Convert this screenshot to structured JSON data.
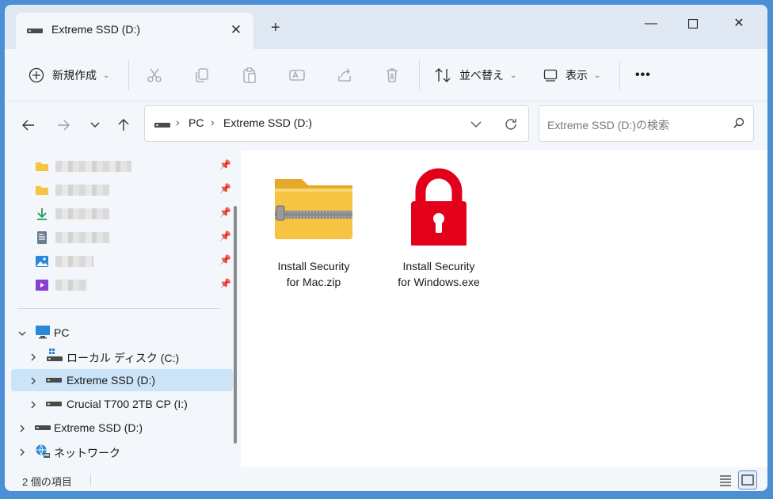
{
  "tab": {
    "title": "Extreme SSD (D:)",
    "close": "✕",
    "new_tab": "+"
  },
  "window_controls": {
    "minimize": "—",
    "maximize": "☐",
    "close": "✕"
  },
  "toolbar": {
    "new_label": "新規作成",
    "sort_label": "並べ替え",
    "view_label": "表示",
    "more_label": "•••"
  },
  "address_bar": {
    "crumbs": [
      "PC",
      "Extreme SSD (D:)"
    ],
    "separator": "›"
  },
  "search": {
    "placeholder": "Extreme SSD (D:)の検索"
  },
  "sidebar": {
    "tree": [
      {
        "label": "PC"
      },
      {
        "label": "ローカル ディスク (C:)"
      },
      {
        "label": "Extreme SSD (D:)"
      },
      {
        "label": "Crucial T700 2TB CP (I:)"
      },
      {
        "label": "Extreme SSD (D:)"
      },
      {
        "label": "ネットワーク"
      }
    ]
  },
  "files": [
    {
      "name_line1": "Install Security",
      "name_line2": "for Mac.zip",
      "icon": "zip-folder-icon"
    },
    {
      "name_line1": "Install Security",
      "name_line2": "for Windows.exe",
      "icon": "red-lock-icon"
    }
  ],
  "status": {
    "item_count": "2 個の項目"
  },
  "colors": {
    "accent": "#0067c0",
    "selected": "#cce4f7",
    "lock_red": "#e3001b",
    "folder_yellow": "#f6c343"
  }
}
